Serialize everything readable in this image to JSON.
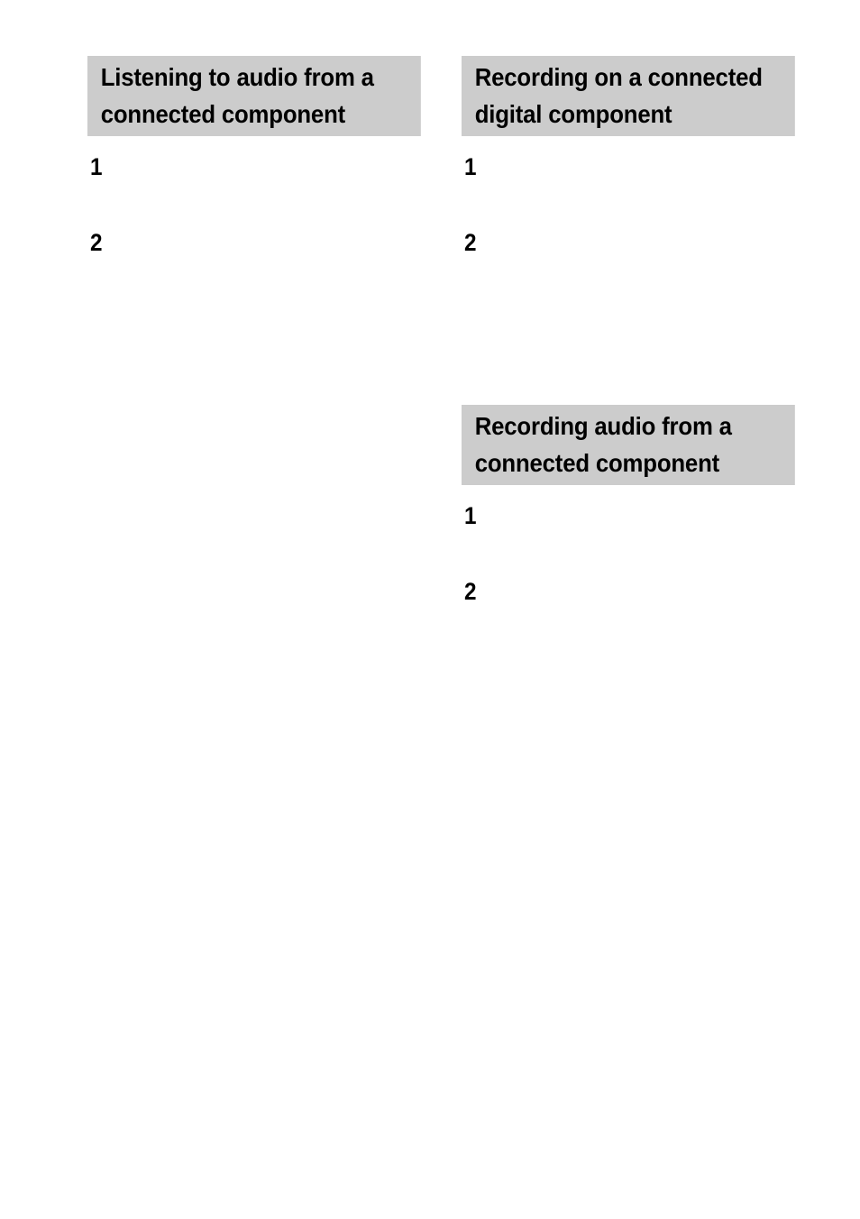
{
  "page": {
    "background_color": "#ffffff",
    "heading_background_color": "#cccccc",
    "text_color": "#000000"
  },
  "columns": {
    "left": {
      "sections": [
        {
          "id": "listening-to-audio",
          "heading_lines": [
            "Listening to audio from a",
            "connected component"
          ],
          "steps": [
            {
              "number": "1",
              "text": ""
            },
            {
              "number": "2",
              "text": ""
            }
          ]
        }
      ]
    },
    "right": {
      "sections": [
        {
          "id": "recording-on-connected-digital",
          "heading_lines": [
            "Recording on a connected",
            "digital component"
          ],
          "steps": [
            {
              "number": "1",
              "text": ""
            },
            {
              "number": "2",
              "text": ""
            }
          ]
        },
        {
          "id": "recording-audio-from-connected",
          "heading_lines": [
            "Recording audio from a",
            "connected component"
          ],
          "steps": [
            {
              "number": "1",
              "text": ""
            },
            {
              "number": "2",
              "text": ""
            }
          ]
        }
      ]
    }
  }
}
